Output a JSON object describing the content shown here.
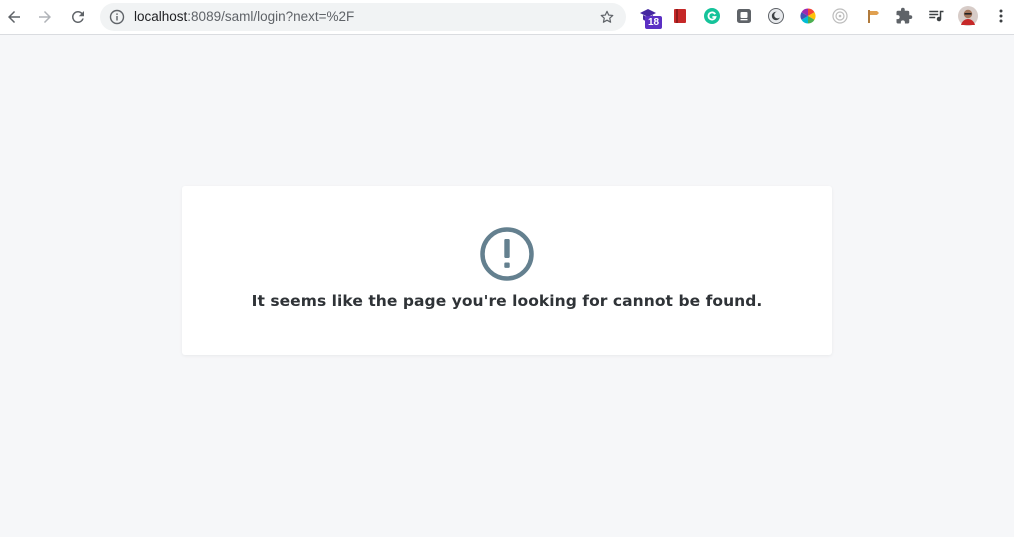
{
  "browser": {
    "address_bar": {
      "host": "localhost",
      "path": ":8089/saml/login?next=%2F"
    },
    "extensions": {
      "badge_count": "18"
    }
  },
  "page": {
    "error_message": "It seems like the page you're looking for cannot be found.",
    "icon": "exclamation-circle-icon",
    "icon_color": "#64808f",
    "background_color": "#f6f7f9"
  }
}
